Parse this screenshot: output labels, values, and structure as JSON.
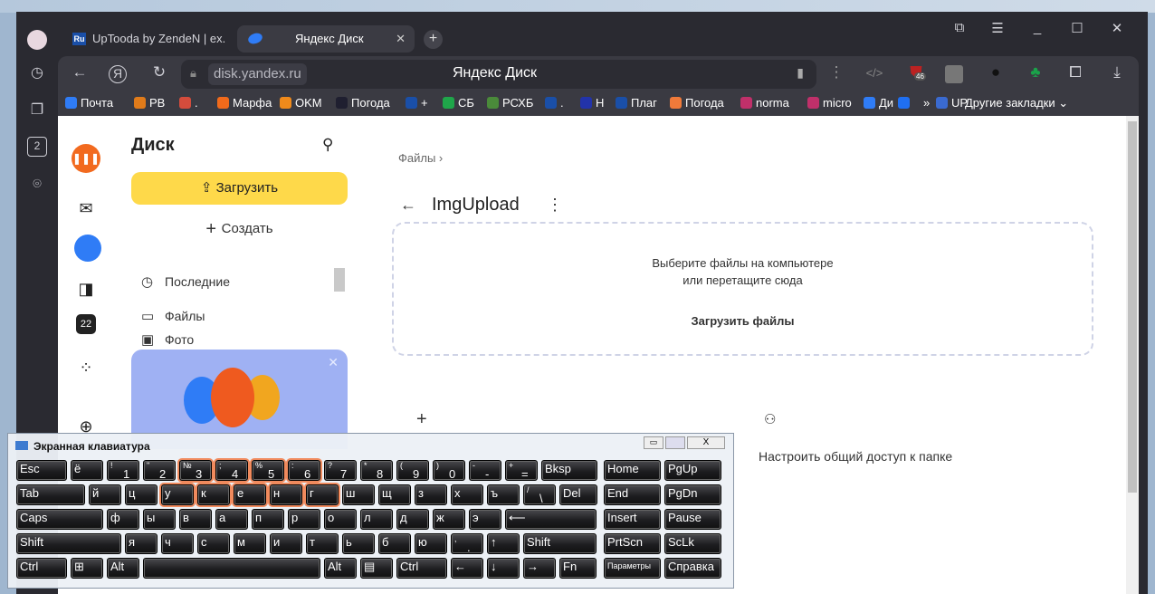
{
  "browser": {
    "tabs": [
      {
        "label": "UpTooda by ZendeN | ex.",
        "icon": "ru-icon"
      },
      {
        "label": "Яндекс Диск",
        "icon": "yandex-disk-icon"
      }
    ],
    "address": "disk.yandex.ru",
    "page_title": "Яндекс Диск",
    "bookmarks": [
      {
        "label": "Почта",
        "color": "#2f7cf6"
      },
      {
        "label": "PB",
        "color": "#e07b1a"
      },
      {
        "label": ".",
        "color": "#d44c3c"
      },
      {
        "label": "Марфа",
        "color": "#f06a1b"
      },
      {
        "label": "OKM",
        "color": "#f08a1b"
      },
      {
        "label": "Погода",
        "color": "#1f1f30"
      },
      {
        "label": "+",
        "color": "#1a4fa8"
      },
      {
        "label": "СБ",
        "color": "#1fa64a"
      },
      {
        "label": "РСХБ",
        "color": "#4a8a3a"
      },
      {
        "label": ".",
        "color": "#1a4fa8"
      },
      {
        "label": "Н",
        "color": "#2233aa"
      },
      {
        "label": "Плаг",
        "color": "#1a4fa8"
      },
      {
        "label": "Погода",
        "color": "#f07a3a"
      },
      {
        "label": "norma",
        "color": "#c0306a"
      },
      {
        "label": "micro",
        "color": "#c0306a"
      },
      {
        "label": "Ди",
        "color": "#2f7cf6"
      },
      {
        "label": "",
        "color": "#1f6ff2"
      },
      {
        "label": "UP",
        "color": "#3a6ad0"
      }
    ],
    "more_bookmarks": "»",
    "other_bookmarks": "Другие закладки",
    "ext_badge": "46",
    "calendar_day": "22"
  },
  "disk": {
    "title": "Диск",
    "upload": "Загрузить",
    "create": "Создать",
    "nav": [
      "Последние",
      "Файлы",
      "Фото"
    ],
    "breadcrumb": "Файлы",
    "folder": "ImgUpload",
    "drop_line1": "Выберите файлы на компьютере",
    "drop_line2": "или перетащите сюда",
    "drop_button": "Загрузить файлы",
    "share": "Настроить общий доступ к папке"
  },
  "keyboard": {
    "title": "Экранная клавиатура",
    "rows": [
      [
        {
          "m": "Esc"
        },
        {
          "m": "ё"
        },
        {
          "s": "!",
          "m": "1"
        },
        {
          "s": "\"",
          "m": "2"
        },
        {
          "s": "№",
          "m": "3"
        },
        {
          "s": ";",
          "m": "4"
        },
        {
          "s": "%",
          "m": "5"
        },
        {
          "s": ":",
          "m": "6"
        },
        {
          "s": "?",
          "m": "7"
        },
        {
          "s": "*",
          "m": "8"
        },
        {
          "s": "(",
          "m": "9"
        },
        {
          "s": ")",
          "m": "0"
        },
        {
          "s": "-",
          "m": "-"
        },
        {
          "s": "+",
          "m": "="
        },
        {
          "m": "Bksp"
        }
      ],
      [
        {
          "m": "Tab"
        },
        {
          "m": "й"
        },
        {
          "m": "ц"
        },
        {
          "m": "у"
        },
        {
          "m": "к"
        },
        {
          "m": "е"
        },
        {
          "m": "н"
        },
        {
          "m": "г"
        },
        {
          "m": "ш"
        },
        {
          "m": "щ"
        },
        {
          "m": "з"
        },
        {
          "m": "х"
        },
        {
          "m": "ъ"
        },
        {
          "s": "/",
          "m": "\\"
        },
        {
          "m": "Del"
        }
      ],
      [
        {
          "m": "Caps"
        },
        {
          "m": "ф"
        },
        {
          "m": "ы"
        },
        {
          "m": "в"
        },
        {
          "m": "а"
        },
        {
          "m": "п"
        },
        {
          "m": "р"
        },
        {
          "m": "о"
        },
        {
          "m": "л"
        },
        {
          "m": "д"
        },
        {
          "m": "ж"
        },
        {
          "m": "э"
        },
        {
          "m": "⟵"
        }
      ],
      [
        {
          "m": "Shift"
        },
        {
          "m": "я"
        },
        {
          "m": "ч"
        },
        {
          "m": "с"
        },
        {
          "m": "м"
        },
        {
          "m": "и"
        },
        {
          "m": "т"
        },
        {
          "m": "ь"
        },
        {
          "m": "б"
        },
        {
          "m": "ю"
        },
        {
          "s": ",",
          "m": "."
        },
        {
          "m": "↑"
        },
        {
          "m": "Shift"
        }
      ],
      [
        {
          "m": "Ctrl"
        },
        {
          "m": "⊞"
        },
        {
          "m": "Alt"
        },
        {
          "m": ""
        },
        {
          "m": "Alt"
        },
        {
          "m": "▤"
        },
        {
          "m": "Ctrl"
        },
        {
          "m": "←"
        },
        {
          "m": "↓"
        },
        {
          "m": "→"
        },
        {
          "m": "Fn"
        }
      ]
    ],
    "nav_rows": [
      [
        "Home",
        "PgUp"
      ],
      [
        "End",
        "PgDn"
      ],
      [
        "Insert",
        "Pause"
      ],
      [
        "PrtScn",
        "ScLk"
      ],
      [
        "Параметры",
        "Справка"
      ]
    ]
  }
}
